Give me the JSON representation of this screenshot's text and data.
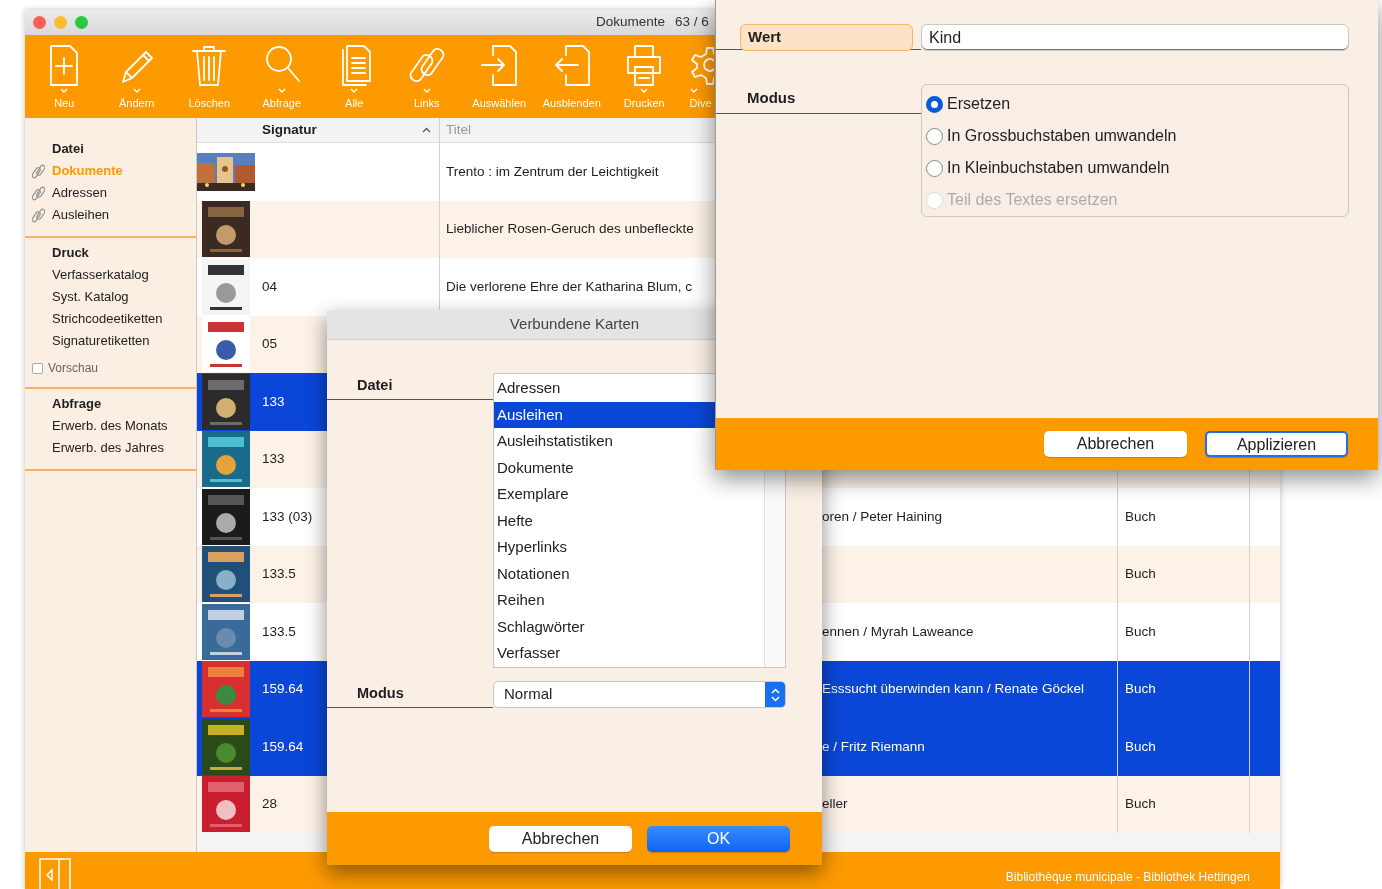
{
  "main_window": {
    "title": "Dokumente",
    "count": "63 / 6"
  },
  "toolbar": [
    {
      "label": "Neu",
      "menu": true
    },
    {
      "label": "Ändern",
      "menu": true
    },
    {
      "label": "Löschen",
      "menu": false
    },
    {
      "label": "Abfrage",
      "menu": true
    },
    {
      "label": "Alle",
      "menu": true
    },
    {
      "label": "Links",
      "menu": true
    },
    {
      "label": "Auswählen",
      "menu": false
    },
    {
      "label": "Ausblenden",
      "menu": false
    },
    {
      "label": "Drucken",
      "menu": true
    },
    {
      "label": "Dive",
      "menu": true
    }
  ],
  "sidebar": {
    "sections": [
      {
        "title": "Datei",
        "items": [
          {
            "label": "Dokumente",
            "kind": "file",
            "selected": true
          },
          {
            "label": "Adressen",
            "kind": "file",
            "selected": false
          },
          {
            "label": "Ausleihen",
            "kind": "file",
            "selected": false
          }
        ]
      },
      {
        "title": "Druck",
        "items": [
          {
            "label": "Verfasserkatalog",
            "kind": "report",
            "selected": false
          },
          {
            "label": "Syst. Katalog",
            "kind": "report",
            "selected": false
          },
          {
            "label": "Strichcodeetiketten",
            "kind": "report",
            "selected": false
          },
          {
            "label": "Signaturetiketten",
            "kind": "report",
            "selected": false
          }
        ],
        "checkbox": {
          "label": "Vorschau",
          "checked": false
        }
      },
      {
        "title": "Abfrage",
        "items": [
          {
            "label": "Erwerb. des Monats",
            "kind": "report",
            "selected": false
          },
          {
            "label": "Erwerb. des Jahres",
            "kind": "report",
            "selected": false
          }
        ]
      }
    ]
  },
  "table": {
    "columns": [
      {
        "label": "Signatur",
        "sorted": true
      },
      {
        "label": "Titel",
        "sorted": false
      }
    ],
    "rows": [
      {
        "title": "Trento : im Zentrum der Leichtigkeit",
        "selected": false
      },
      {
        "title": "Lieblicher Rosen-Geruch des unbefleckte",
        "selected": false
      },
      {
        "signatur": "04",
        "title": "Die verlorene Ehre der Katharina Blum, c",
        "selected": false
      },
      {
        "signatur": "05",
        "selected": false
      },
      {
        "signatur": "133",
        "selected": true
      },
      {
        "signatur": "133",
        "selected": false
      },
      {
        "signatur": "133 (03)",
        "title_end": "oren / Peter Haining",
        "type": "Buch",
        "selected": false
      },
      {
        "signatur": "133.5",
        "type": "Buch",
        "selected": false
      },
      {
        "signatur": "133.5",
        "title_end": "ennen / Myrah Laweance",
        "type": "Buch",
        "selected": false
      },
      {
        "signatur": "159.64",
        "title_end": "Esssucht überwinden kann / Renate Göckel",
        "type": "Buch",
        "selected": true
      },
      {
        "signatur": "159.64",
        "title_end": "e / Fritz Riemann",
        "type": "Buch",
        "selected": true
      },
      {
        "signatur": "28",
        "title_end": "eller",
        "type": "Buch",
        "selected": false
      }
    ]
  },
  "footer": {
    "library": "Bibliothèque municipale - Bibliothek Hettingen"
  },
  "link_dialog": {
    "title": "Verbundene Karten",
    "file_label": "Datei",
    "files": [
      {
        "label": "Adressen",
        "selected": false
      },
      {
        "label": "Ausleihen",
        "selected": true
      },
      {
        "label": "Ausleihstatistiken",
        "selected": false
      },
      {
        "label": "Dokumente",
        "selected": false
      },
      {
        "label": "Exemplare",
        "selected": false
      },
      {
        "label": "Hefte",
        "selected": false
      },
      {
        "label": "Hyperlinks",
        "selected": false
      },
      {
        "label": "Notationen",
        "selected": false
      },
      {
        "label": "Reihen",
        "selected": false
      },
      {
        "label": "Schlagwörter",
        "selected": false
      },
      {
        "label": "Verfasser",
        "selected": false
      }
    ],
    "mode_label": "Modus",
    "mode": "Normal",
    "buttons": [
      {
        "label": "Abbrechen",
        "default": false
      },
      {
        "label": "OK",
        "default": true
      }
    ]
  },
  "replace_dialog": {
    "value_label": "Wert",
    "value": "Kind",
    "mode_label": "Modus",
    "modes": [
      {
        "label": "Ersetzen",
        "selected": true,
        "disabled": false
      },
      {
        "label": "In Grossbuchstaben umwandeln",
        "selected": false,
        "disabled": false
      },
      {
        "label": "In Kleinbuchstaben umwandeln",
        "selected": false,
        "disabled": false
      },
      {
        "label": "Teil des Textes ersetzen",
        "selected": false,
        "disabled": true
      }
    ],
    "buttons": [
      {
        "label": "Abbrechen",
        "default": false
      },
      {
        "label": "Applizieren",
        "default": true
      }
    ]
  }
}
